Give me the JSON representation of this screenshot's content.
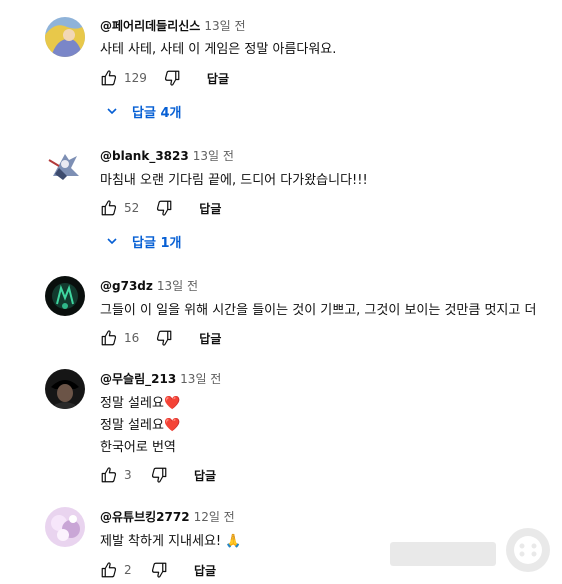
{
  "comments": [
    {
      "author": "@페어리데들리신스",
      "time": "13일 전",
      "lines": [
        "사테 사테, 사테 이 게임은 정말 아름다워요."
      ],
      "likes": "129",
      "reply_label": "답글",
      "replies_label": "답글 4개"
    },
    {
      "author": "@blank_3823",
      "time": "13일 전",
      "lines": [
        "마침내 오랜 기다림 끝에, 드디어 다가왔습니다!!!"
      ],
      "likes": "52",
      "reply_label": "답글",
      "replies_label": "답글 1개"
    },
    {
      "author": "@g73dz",
      "time": "13일 전",
      "lines": [
        "그들이 이 일을 위해 시간을 들이는 것이 기쁘고, 그것이 보이는 것만큼 멋지고 더"
      ],
      "likes": "16",
      "reply_label": "답글"
    },
    {
      "author": "@무슬림_213",
      "time": "13일 전",
      "lines": [
        "정말 설레요",
        "정말 설레요"
      ],
      "translate_label": "한국어로 번역",
      "likes": "3",
      "reply_label": "답글"
    },
    {
      "author": "@유튜브킹2772",
      "time": "12일 전",
      "lines": [
        "제발 착하게 지내세요!"
      ],
      "likes": "2",
      "reply_label": "답글"
    }
  ],
  "emoji": {
    "heart": "❤️",
    "pray": "🙏"
  },
  "icons": {
    "like": "thumb-up-icon",
    "dislike": "thumb-down-icon",
    "expand": "chevron-down-icon"
  },
  "colors": {
    "link_blue": "#065fd4",
    "secondary_text": "#606060",
    "primary_text": "#0f0f0f"
  }
}
